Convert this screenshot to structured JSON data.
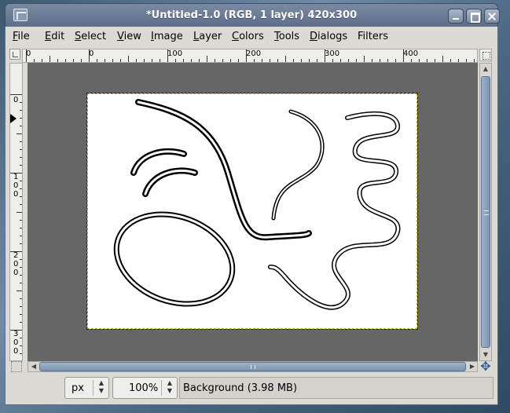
{
  "window": {
    "title": "*Untitled-1.0 (RGB, 1 layer) 420x300",
    "app_icon": "gimp-image-icon",
    "buttons": [
      "minimize-icon",
      "maximize-icon",
      "close-icon"
    ]
  },
  "menu": {
    "items": [
      {
        "mnemonic": "F",
        "rest": "ile"
      },
      {
        "mnemonic": "E",
        "rest": "dit"
      },
      {
        "mnemonic": "S",
        "rest": "elect"
      },
      {
        "mnemonic": "V",
        "rest": "iew"
      },
      {
        "mnemonic": "I",
        "rest": "mage"
      },
      {
        "mnemonic": "L",
        "rest": "ayer"
      },
      {
        "mnemonic": "C",
        "rest": "olors"
      },
      {
        "mnemonic": "T",
        "rest": "ools"
      },
      {
        "mnemonic": "D",
        "rest": "ialogs"
      },
      {
        "mnemonic": "",
        "rest": "Filters"
      }
    ]
  },
  "rulers": {
    "horizontal_labels": [
      "0",
      "0",
      "100",
      "200",
      "300",
      "400"
    ],
    "vertical_labels": [
      "0",
      "100",
      "200",
      "300"
    ]
  },
  "canvas": {
    "background_color": "#666666",
    "image_width": 420,
    "image_height": 300,
    "image_background": "#ffffff",
    "stroke_color": "#000000"
  },
  "status": {
    "unit": "px",
    "zoom": "100%",
    "message": "Background (3.98 MB)"
  },
  "colors": {
    "titlebar": "#6b7b96",
    "window_bg": "#dcdad5",
    "scroll_thumb": "#8ba1bb"
  }
}
